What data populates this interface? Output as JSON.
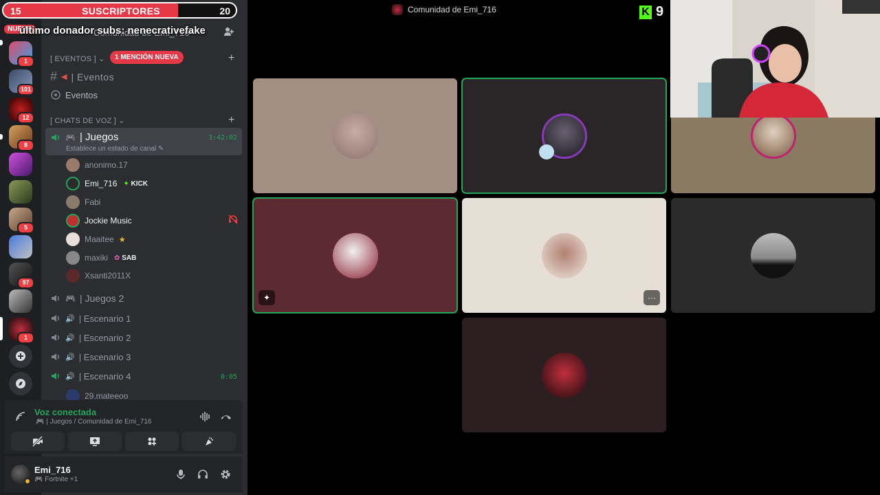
{
  "overlay": {
    "sub_goal_current": "15",
    "sub_goal_label": "SUSCRIPTORES",
    "sub_goal_target": "20",
    "sub_goal_progress": 0.75,
    "new_tag": "NUEVO",
    "last_donor": "último donador subs: nenecrativefake",
    "kick_count": "9"
  },
  "rail": {
    "servers": [
      {
        "badge": "1",
        "color": "#e04b6a"
      },
      {
        "badge": "101",
        "color": "#3a4a66"
      },
      {
        "badge": "12",
        "color": "#7a1010"
      },
      {
        "badge": "8",
        "color": "#b87a3a"
      },
      {
        "badge": "",
        "color": "#8a3ab8"
      },
      {
        "badge": "",
        "color": "#5a6a3a"
      },
      {
        "badge": "5",
        "color": "#a08060"
      },
      {
        "badge": "",
        "color": "#2a4a9a"
      },
      {
        "badge": "97",
        "color": "#333"
      },
      {
        "badge": "",
        "color": "#777"
      },
      {
        "badge": "1",
        "color": "#6a1010"
      }
    ]
  },
  "sidebar": {
    "server_name": "Comunidad de Emi_716",
    "categories": {
      "events": "[ EVENTOS ]",
      "mention": "1 MENCIÓN NUEVA",
      "voice": "[ CHATS DE VOZ ]"
    },
    "channels": {
      "events_text": "| Eventos",
      "events_stage": "Eventos",
      "juegos": "| Juegos",
      "juegos_time": "3:42:02",
      "juegos_status": "Establece un estado de canal",
      "juegos2": "| Juegos 2",
      "esc1": "| Escenario 1",
      "esc2": "| Escenario 2",
      "esc3": "| Escenario 3",
      "esc4": "| Escenario 4",
      "esc4_time": "0:05"
    },
    "members": [
      {
        "name": "anonimo.17",
        "tag": "",
        "color": "#9a7a6a"
      },
      {
        "name": "Emi_716",
        "tag": "KICK",
        "color": "#2a2a2a"
      },
      {
        "name": "Fabi",
        "tag": "",
        "color": "#8a7a6a"
      },
      {
        "name": "Jockie Music",
        "tag": "",
        "color": "#c03030"
      },
      {
        "name": "Maaitee",
        "tag": "",
        "color": "#e8e0d8"
      },
      {
        "name": "maxiki",
        "tag": "SAB",
        "color": "#888"
      },
      {
        "name": "Xsanti2011X",
        "tag": "",
        "color": "#5a2a2a"
      }
    ],
    "esc4_member": "29.mateeoo"
  },
  "voice_panel": {
    "status": "Voz conectada",
    "location": "| Juegos / Comunidad de Emi_716"
  },
  "user_panel": {
    "name": "Emi_716",
    "activity": "Fortnite +1"
  },
  "stage": {
    "title": "Comunidad de Emi_716"
  },
  "colors": {
    "accent_red": "#e53947",
    "speaking_green": "#23a55a",
    "kick_green": "#53fc18"
  }
}
